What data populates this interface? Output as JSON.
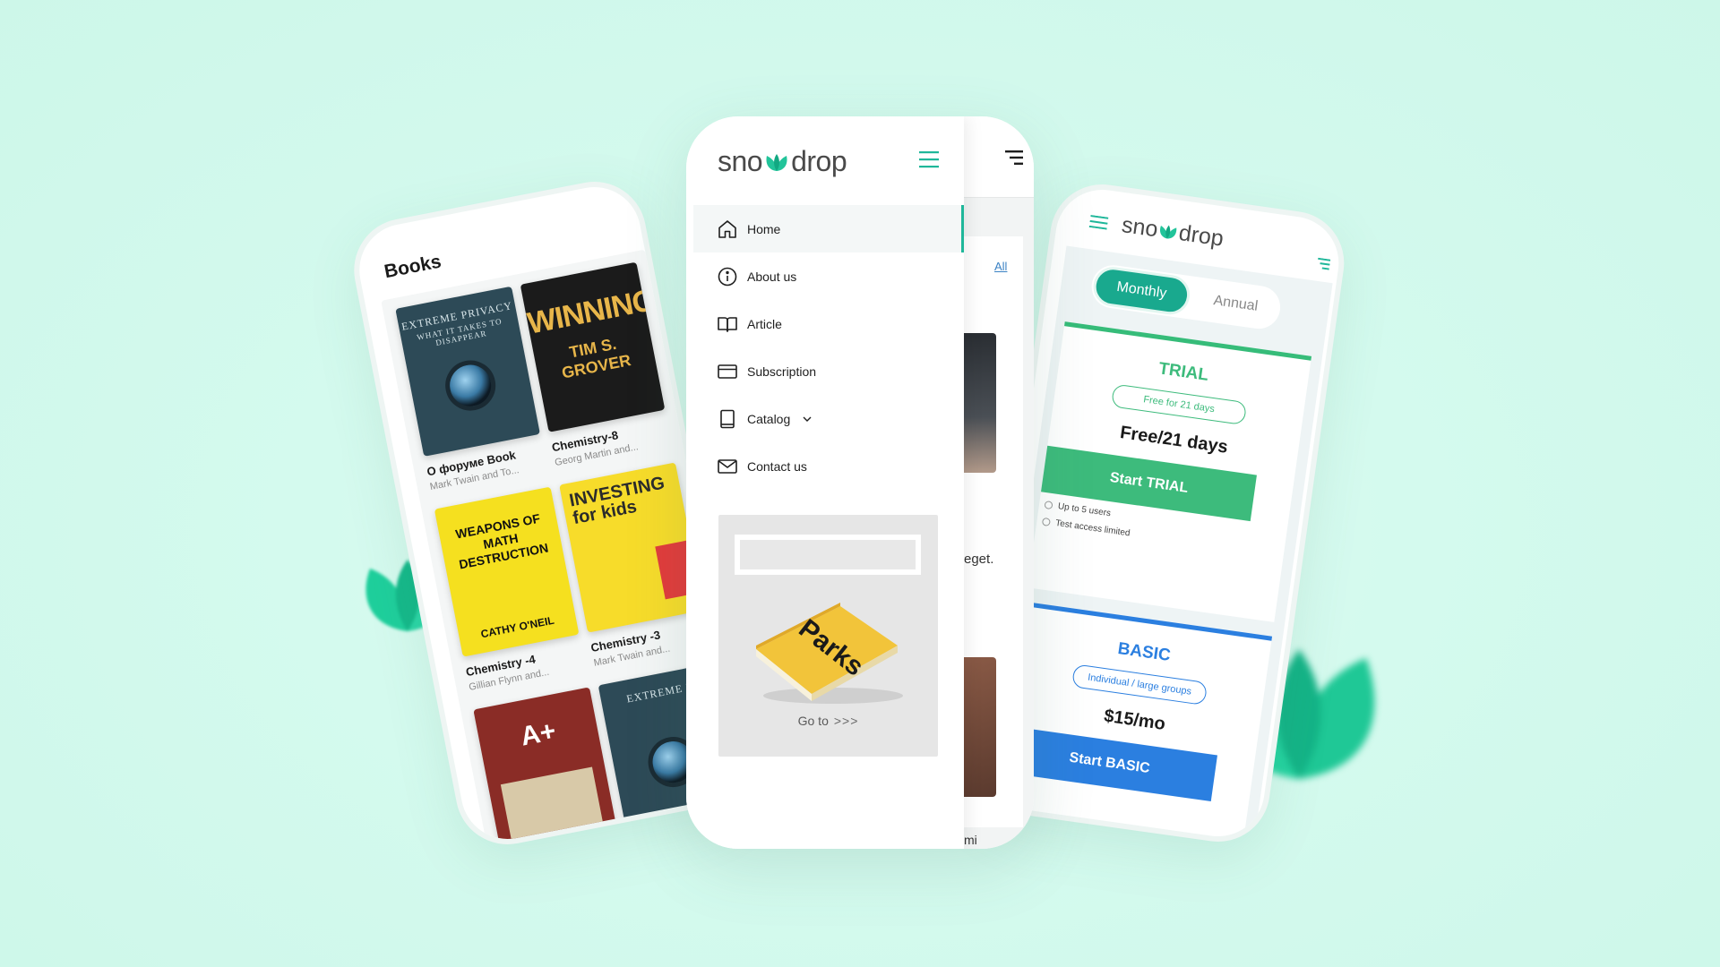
{
  "brand": {
    "logo_prefix": "sno",
    "logo_suffix": "drop",
    "accent": "#1fb79a"
  },
  "books_screen": {
    "title": "Books",
    "books": [
      {
        "title": "О форуме Book",
        "author": "Mark Twain and To...",
        "cover_lines": [
          "EXTREME PRIVACY",
          "WHAT IT TAKES TO DISAPPEAR"
        ]
      },
      {
        "title": "Chemistry-8",
        "author": "Georg Martin and...",
        "cover_lines": [
          "WINNING",
          "TIM S. GROVER"
        ]
      },
      {
        "title": "Chemistry -4",
        "author": "Gillian Flynn and...",
        "cover_lines": [
          "WEAPONS OF MATH DESTRUCTION",
          "CATHY O'NEIL"
        ]
      },
      {
        "title": "Chemistry -3",
        "author": "Mark Twain and...",
        "cover_lines": [
          "INVESTING for kids"
        ]
      },
      {
        "title": "",
        "author": "",
        "cover_lines": [
          "A+"
        ]
      },
      {
        "title": "",
        "author": "",
        "cover_lines": [
          "EXTREME P"
        ]
      }
    ]
  },
  "menu_screen": {
    "items": [
      {
        "label": "Home",
        "icon": "home-icon",
        "active": true
      },
      {
        "label": "About us",
        "icon": "info-icon",
        "active": false
      },
      {
        "label": "Article",
        "icon": "book-open-icon",
        "active": false
      },
      {
        "label": "Subscription",
        "icon": "credit-card-icon",
        "active": false
      },
      {
        "label": "Catalog",
        "icon": "tablet-icon",
        "active": false,
        "has_dropdown": true
      },
      {
        "label": "Contact us",
        "icon": "mail-icon",
        "active": false
      }
    ],
    "promo": {
      "book_title": "Parks",
      "cta_label": "Go to",
      "cta_arrows": ">>>"
    },
    "background_link": "All",
    "background_text": "eget.",
    "background_tail": "mi"
  },
  "pricing_screen": {
    "toggle": {
      "active": "Monthly",
      "inactive": "Annual"
    },
    "plans": [
      {
        "name": "TRIAL",
        "tag": "Free for 21 days",
        "price": "Free/21 days",
        "button": "Start TRIAL",
        "color": "#3dbb7c",
        "features": [
          "Up to 5 users",
          "Test access limited"
        ]
      },
      {
        "name": "BASIC",
        "tag": "Individual / large groups",
        "price": "$15/mo",
        "button": "Start BASIC",
        "color": "#2b7fe0",
        "features": []
      }
    ]
  }
}
